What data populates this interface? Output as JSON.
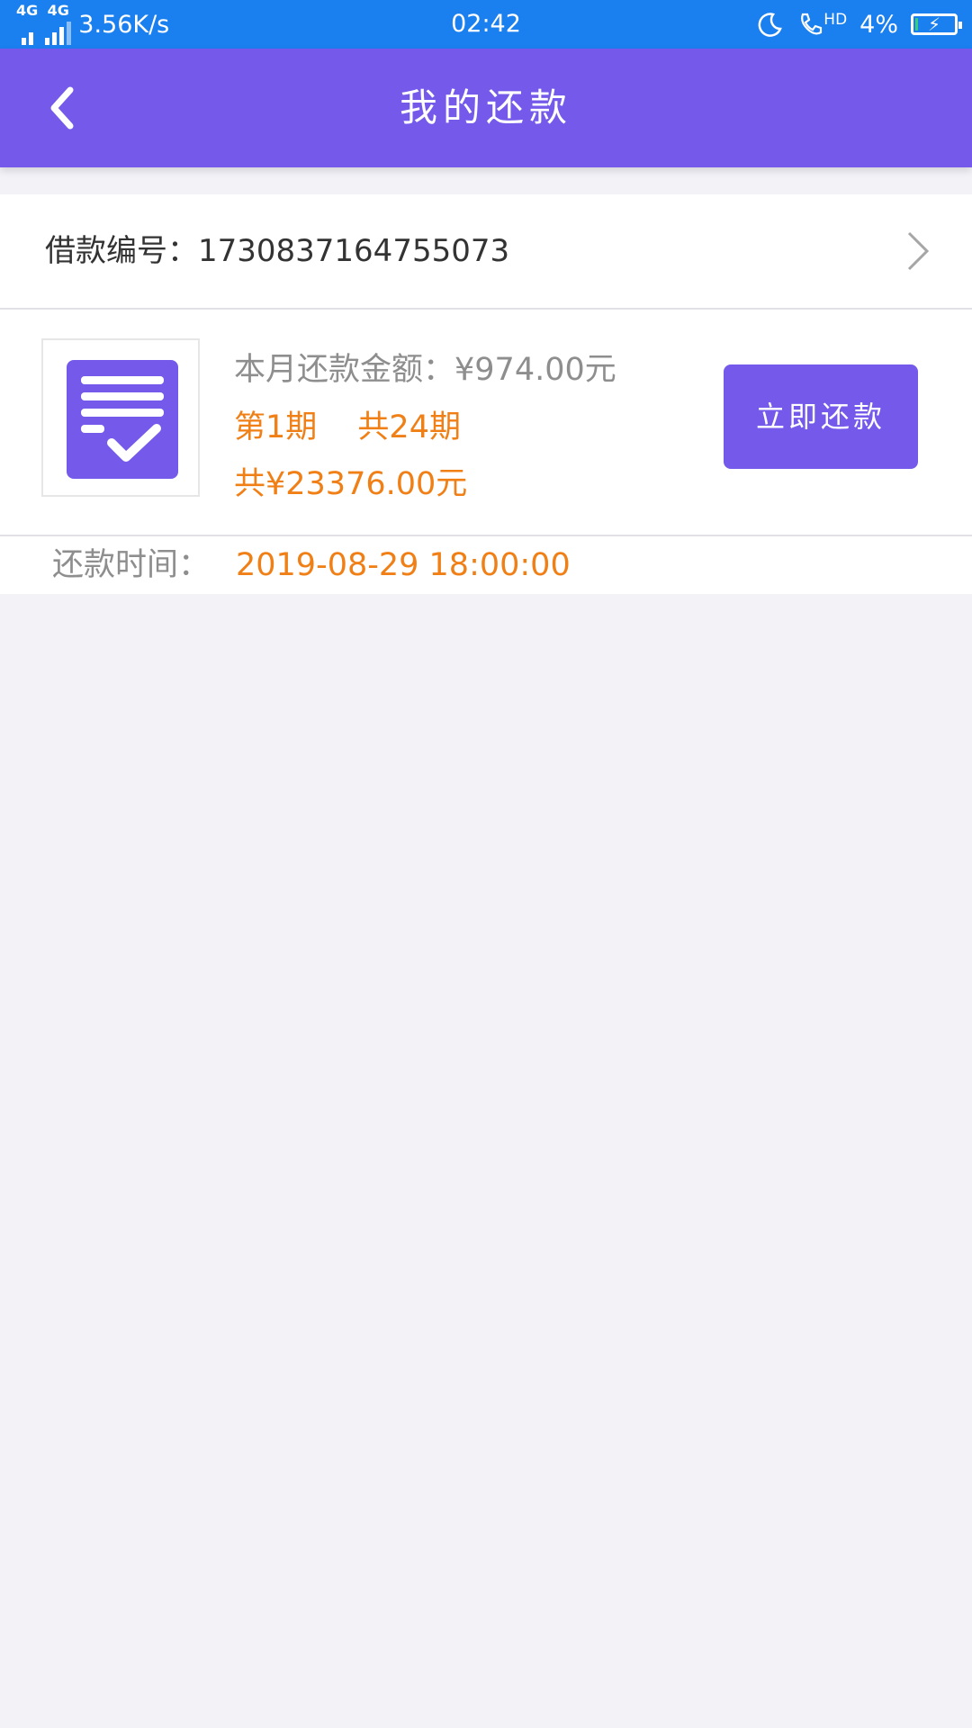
{
  "status_bar": {
    "network_left": "4G",
    "network_right": "4G",
    "speed": "3.56K/s",
    "time": "02:42",
    "hd": "HD",
    "battery": "4%",
    "battery_level": 0.04
  },
  "header": {
    "title": "我的还款"
  },
  "loan": {
    "label": "借款编号：",
    "number": "17308371647550​73"
  },
  "repayment": {
    "amount_label": "本月还款金额：",
    "amount_value": "¥974.00元",
    "period": "第1期",
    "total_period": "共24期",
    "total_amount": "共¥23376.00元",
    "pay_button": "立即还款"
  },
  "time_row": {
    "label": "还款时间：",
    "value": "2019-08-29 18:00:00"
  },
  "colors": {
    "status_bar": "#1a7fef",
    "header": "#7459ea",
    "accent_orange": "#f07f16",
    "background": "#f2f2f7"
  }
}
